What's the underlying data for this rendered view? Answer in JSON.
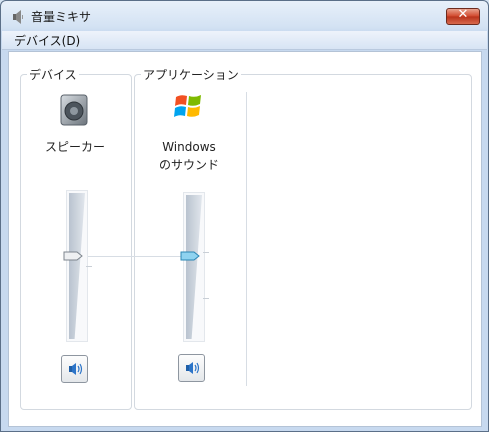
{
  "window": {
    "title": "音量ミキサ"
  },
  "menu": {
    "items": [
      {
        "label": "デバイス(D)"
      }
    ]
  },
  "device_group": {
    "label": "デバイス",
    "device": {
      "name": "スピーカー",
      "icon": "speaker-icon",
      "volume_level": 0.55,
      "muted": false
    }
  },
  "apps_group": {
    "label": "アプリケーション",
    "app": {
      "name_line1": "Windows",
      "name_line2": "のサウンド",
      "icon": "windows-logo-icon",
      "volume_level": 0.55,
      "muted": false
    }
  },
  "colors": {
    "accent": "#3aa7d8",
    "close_red": "#c9452a"
  }
}
